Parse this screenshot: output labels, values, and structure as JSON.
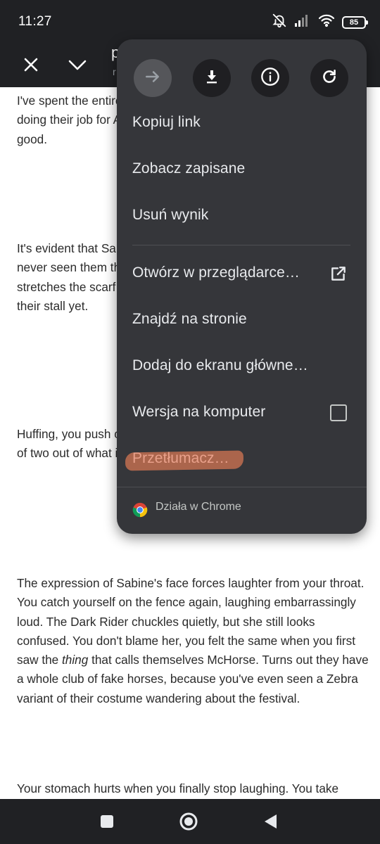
{
  "status_bar": {
    "time": "11:27",
    "battery": "85"
  },
  "toolbar": {
    "title": "p",
    "url": "r"
  },
  "article": {
    "paragraphs": [
      "I've spent the entire day talking to people, who don't seem to like doing their job for Alex and Linda have somehow. That can't be good.",
      "It's evident that Sabine is slowing down, hiding the strain. You've never seen them this tired all the time, cocky and confident. She stretches the scarf over her eyes. You swallow; you haven't seen their stall yet.",
      "Huffing, you push off the fence to speak again when the sounds of two out of what is most definitely before staring at you.",
      "The expression of Sabine's face forces laughter from your throat. You catch yourself on the fence again, laughing embarrassingly loud. The Dark Rider chuckles quietly, but she still looks confused. You don't blame her, you felt the same when you first saw the thing that calls themselves McHorse. Turns out they have a whole club of fake horses, because you've even seen a Zebra variant of their costume wandering about the festival.",
      "Your stomach hurts when you finally stop laughing. You take"
    ],
    "p4_emphasis": "thing"
  },
  "menu": {
    "actions": [
      {
        "name": "forward-icon",
        "enabled": false
      },
      {
        "name": "download-icon",
        "enabled": true
      },
      {
        "name": "info-icon",
        "enabled": true
      },
      {
        "name": "refresh-icon",
        "enabled": true
      }
    ],
    "items": [
      {
        "label": "Kopiuj link"
      },
      {
        "label": "Zobacz zapisane"
      },
      {
        "label": "Usuń wynik"
      },
      {
        "label": "Otwórz w przeglądarce…",
        "icon": "open-in-new-icon"
      },
      {
        "label": "Znajdź na stronie"
      },
      {
        "label": "Dodaj do ekranu główne…"
      },
      {
        "label": "Wersja na komputer",
        "checked": false
      },
      {
        "label": "Przetłumacz…",
        "color": "#e8a08a"
      }
    ],
    "footer": "Działa w Chrome"
  },
  "colors": {
    "bar": "#202124",
    "menu_bg": "#35363a",
    "highlight": "#b86a4f"
  }
}
